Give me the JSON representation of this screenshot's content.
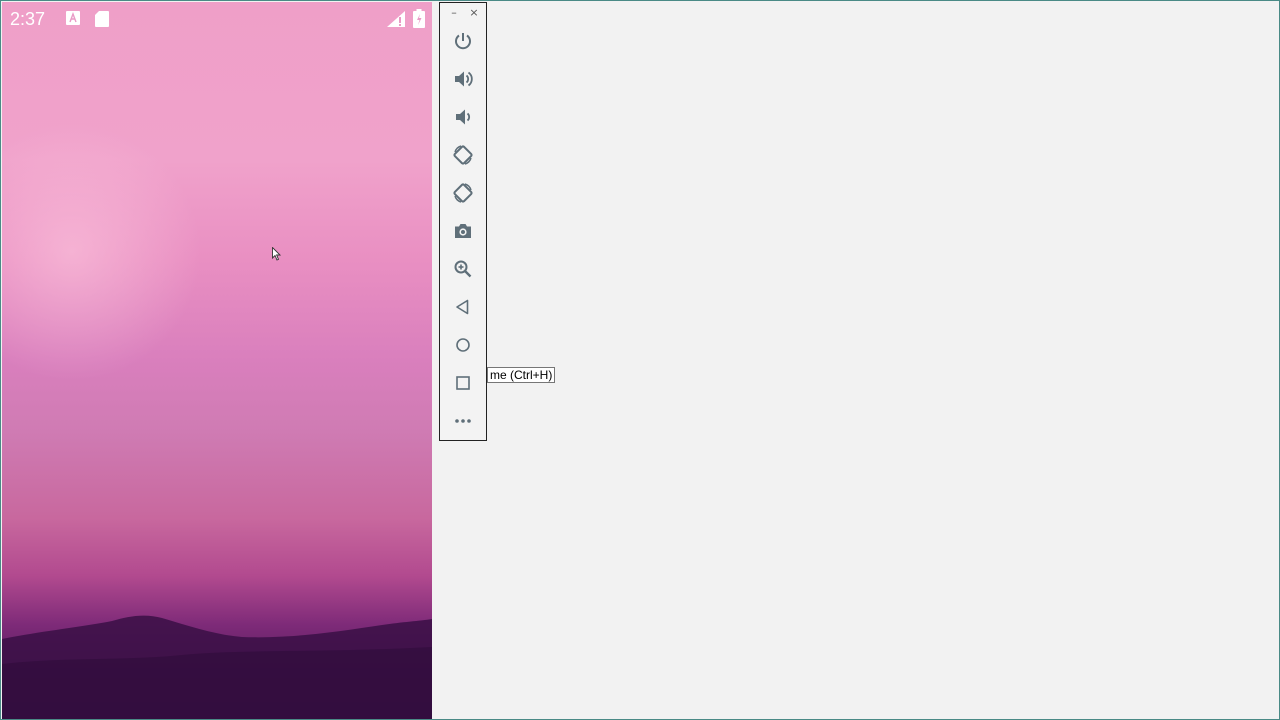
{
  "status_bar": {
    "time": "2:37",
    "icons": [
      "a-notification-icon",
      "sd-card-icon",
      "signal-icon",
      "battery-icon"
    ]
  },
  "emulator_toolbar": {
    "window_controls": {
      "minimize": "–",
      "close": "×"
    },
    "buttons": [
      {
        "name": "power",
        "icon": "power-icon"
      },
      {
        "name": "volume-up",
        "icon": "volume-up-icon"
      },
      {
        "name": "volume-down",
        "icon": "volume-down-icon"
      },
      {
        "name": "rotate-left",
        "icon": "rotate-left-icon"
      },
      {
        "name": "rotate-right",
        "icon": "rotate-right-icon"
      },
      {
        "name": "screenshot",
        "icon": "camera-icon"
      },
      {
        "name": "zoom",
        "icon": "zoom-in-icon"
      },
      {
        "name": "back",
        "icon": "back-triangle-icon"
      },
      {
        "name": "home",
        "icon": "home-circle-icon"
      },
      {
        "name": "overview",
        "icon": "overview-square-icon"
      },
      {
        "name": "more",
        "icon": "more-dots-icon"
      }
    ],
    "icon_color": "#5f6f79"
  },
  "tooltip": {
    "text": "me (Ctrl+H)"
  },
  "colors": {
    "wallpaper_top": "#ef9fc8",
    "wallpaper_bottom": "#3f1448",
    "background": "#f2f2f2"
  }
}
